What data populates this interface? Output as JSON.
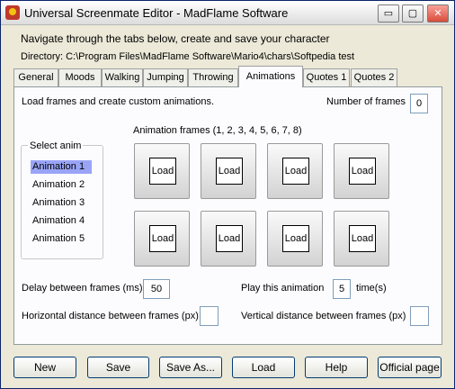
{
  "window": {
    "title": "Universal Screenmate Editor - MadFlame Software",
    "minimize": "▭",
    "maximize": "▢",
    "close": "✕"
  },
  "intro": {
    "instruction": "Navigate through the tabs below, create and save your character",
    "directory": "Directory: C:\\Program Files\\MadFlame Software\\Mario4\\chars\\Softpedia test"
  },
  "tabs": [
    "General",
    "Moods",
    "Walking",
    "Jumping",
    "Throwing",
    "Animations",
    "Quotes 1",
    "Quotes 2"
  ],
  "active_tab": "Animations",
  "animations": {
    "description": "Load frames and create custom animations.",
    "number_of_frames_label": "Number of frames",
    "number_of_frames_value": "0",
    "frames_heading": "Animation frames (1, 2, 3, 4, 5, 6, 7, 8)",
    "select_anim_label": "Select anim",
    "anims": [
      "Animation 1",
      "Animation 2",
      "Animation 3",
      "Animation 4",
      "Animation 5"
    ],
    "selected_anim": "Animation 1",
    "frame_button_label": "Load",
    "delay_label": "Delay between frames (ms)",
    "delay_value": "50",
    "play_label": "Play this animation",
    "play_value": "5",
    "times_label": "time(s)",
    "hdist_label": "Horizontal distance between frames (px)",
    "hdist_value": "",
    "vdist_label": "Vertical distance between frames (px)",
    "vdist_value": ""
  },
  "buttons": {
    "new": "New",
    "save": "Save",
    "save_as": "Save As...",
    "load": "Load",
    "help": "Help",
    "official_page": "Official page"
  }
}
